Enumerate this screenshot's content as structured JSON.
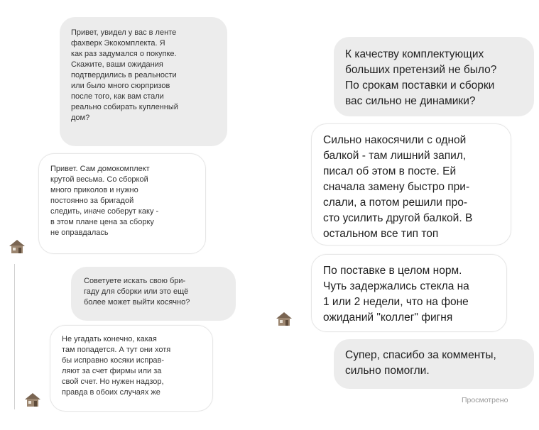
{
  "left_column": {
    "messages": [
      {
        "id": "l1",
        "type": "sent",
        "text": "Привет, увидел у вас в ленте\nфахверк Экокомплекта. Я\nкак раз задумался о покупке.\nСкажите, ваши ожидания\nподтвердились в реальности\nили было много сюрпризов\nпосле того, как вам стали\nреально собирать купленный\nдом?"
      },
      {
        "id": "l2",
        "type": "received",
        "text": "Привет. Сам домокомплект\nкрутой весьма. Со сборкой\nмного приколов и нужно\nпостоянно за бригадой\nследить, иначе соберут каку -\nв этом плане цена за сборку\nне оправдалась"
      },
      {
        "id": "l3",
        "type": "sent",
        "text": "Советуете искать свою бри-\nгаду для сборки или это ещё\nболее может выйти косячно?"
      },
      {
        "id": "l4",
        "type": "received",
        "text": "Не угадать конечно, какая\nтам попадется. А тут они хотя\nбы исправно косяки исправ-\nляют за счет фирмы или за\nсвой счет. Но нужен надзор,\nправда в обоих случаях же"
      }
    ]
  },
  "right_column": {
    "messages": [
      {
        "id": "r1",
        "type": "sent",
        "text": "К качеству комплектующих\nбольших претензий не было?\nПо срокам поставки и сборки\nвас сильно не динамики?"
      },
      {
        "id": "r2",
        "type": "received",
        "text": "Сильно накосячили с одной\nбалкой - там лишний запил,\nписал об этом в посте. Ей\nсначала замену быстро при-\nслали, а потом решили про-\nсто усилить другой балкой. В\nостальном все тип топ"
      },
      {
        "id": "r3",
        "type": "received",
        "text": "По поставке в целом норм.\nЧуть задержались стекла на\n1 или 2 недели, что на фоне\nожиданий \"коллег\" фигня"
      },
      {
        "id": "r4",
        "type": "sent",
        "text": "Супер, спасибо за комменты,\nсильно помогли."
      }
    ],
    "status": "Просмотрено"
  },
  "avatar_icon": "house-avatar-icon",
  "colors": {
    "sent_bubble": "#ececec",
    "received_bubble": "#ffffff",
    "status_text": "#9a9a9a"
  }
}
